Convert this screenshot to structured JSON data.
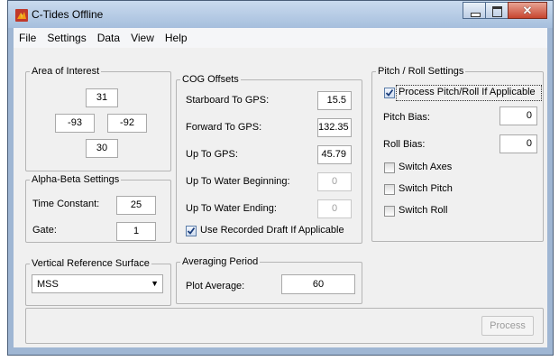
{
  "window": {
    "title": "C-Tides Offline",
    "minimize_icon": "minimize-icon",
    "maximize_icon": "maximize-icon",
    "close_glyph": "✕"
  },
  "menu": [
    "File",
    "Settings",
    "Data",
    "View",
    "Help"
  ],
  "area_of_interest": {
    "legend": "Area of Interest",
    "north": "31",
    "west": "-93",
    "east": "-92",
    "south": "30"
  },
  "alpha_beta": {
    "legend": "Alpha-Beta Settings",
    "time_constant_label": "Time Constant:",
    "time_constant": "25",
    "gate_label": "Gate:",
    "gate": "1"
  },
  "vertical_reference": {
    "legend": "Vertical Reference Surface",
    "selected": "MSS"
  },
  "cog_offsets": {
    "legend": "COG Offsets",
    "rows": [
      {
        "label": "Starboard To GPS:",
        "value": "15.5"
      },
      {
        "label": "Forward To GPS:",
        "value": "132.35"
      },
      {
        "label": "Up To GPS:",
        "value": "45.79"
      },
      {
        "label": "Up To Water Beginning:",
        "value": "0"
      },
      {
        "label": "Up To Water Ending:",
        "value": "0"
      }
    ],
    "use_recorded_draft": "Use Recorded Draft If Applicable"
  },
  "averaging": {
    "legend": "Averaging Period",
    "plot_average_label": "Plot Average:",
    "plot_average": "60"
  },
  "pitch_roll": {
    "legend": "Pitch / Roll Settings",
    "process_label": "Process Pitch/Roll If Applicable",
    "pitch_bias_label": "Pitch Bias:",
    "pitch_bias": "0",
    "roll_bias_label": "Roll Bias:",
    "roll_bias": "0",
    "switch_axes": "Switch Axes",
    "switch_pitch": "Switch Pitch",
    "switch_roll": "Switch Roll"
  },
  "process_button": "Process",
  "colors": {
    "title_bar": "#b7cbe5",
    "close_button": "#c7452f",
    "panel_background": "#f0f0f0"
  }
}
